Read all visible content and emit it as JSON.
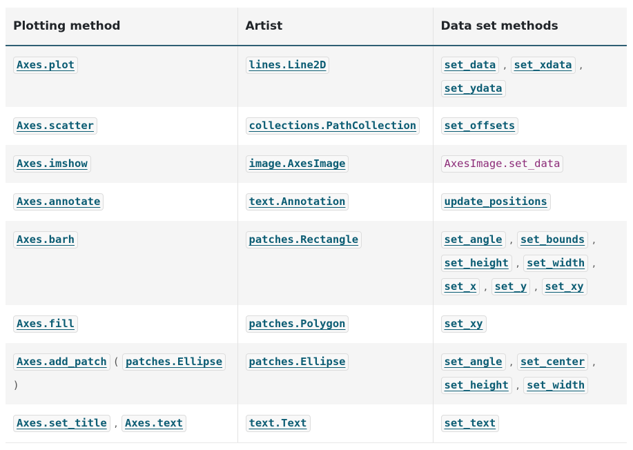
{
  "table": {
    "headers": [
      "Plotting method",
      "Artist",
      "Data set methods"
    ],
    "rows": [
      {
        "method": [
          {
            "t": "Axes.plot",
            "link": true
          }
        ],
        "artist": [
          {
            "t": "lines.Line2D",
            "link": true
          }
        ],
        "data_methods": [
          {
            "t": "set_data",
            "link": true
          },
          {
            "s": ","
          },
          {
            "t": "set_xdata",
            "link": true
          },
          {
            "s": ","
          },
          {
            "t": "set_ydata",
            "link": true
          }
        ]
      },
      {
        "method": [
          {
            "t": "Axes.scatter",
            "link": true
          }
        ],
        "artist": [
          {
            "t": "collections.PathCollection",
            "link": true
          }
        ],
        "data_methods": [
          {
            "t": "set_offsets",
            "link": true
          }
        ]
      },
      {
        "method": [
          {
            "t": "Axes.imshow",
            "link": true
          }
        ],
        "artist": [
          {
            "t": "image.AxesImage",
            "link": true
          }
        ],
        "data_methods": [
          {
            "t": "AxesImage.set_data",
            "link": false
          }
        ]
      },
      {
        "method": [
          {
            "t": "Axes.annotate",
            "link": true
          }
        ],
        "artist": [
          {
            "t": "text.Annotation",
            "link": true
          }
        ],
        "data_methods": [
          {
            "t": "update_positions",
            "link": true
          }
        ]
      },
      {
        "method": [
          {
            "t": "Axes.barh",
            "link": true
          }
        ],
        "artist": [
          {
            "t": "patches.Rectangle",
            "link": true
          }
        ],
        "data_methods": [
          {
            "t": "set_angle",
            "link": true
          },
          {
            "s": ","
          },
          {
            "t": "set_bounds",
            "link": true
          },
          {
            "s": ","
          },
          {
            "t": "set_height",
            "link": true
          },
          {
            "s": ","
          },
          {
            "t": "set_width",
            "link": true
          },
          {
            "s": ","
          },
          {
            "t": "set_x",
            "link": true
          },
          {
            "s": ","
          },
          {
            "t": "set_y",
            "link": true
          },
          {
            "s": ","
          },
          {
            "t": "set_xy",
            "link": true
          }
        ]
      },
      {
        "method": [
          {
            "t": "Axes.fill",
            "link": true
          }
        ],
        "artist": [
          {
            "t": "patches.Polygon",
            "link": true
          }
        ],
        "data_methods": [
          {
            "t": "set_xy",
            "link": true
          }
        ]
      },
      {
        "method": [
          {
            "t": "Axes.add_patch",
            "link": true
          },
          {
            "s": "("
          },
          {
            "t": "patches.Ellipse",
            "link": true
          },
          {
            "s": ")"
          }
        ],
        "artist": [
          {
            "t": "patches.Ellipse",
            "link": true
          }
        ],
        "data_methods": [
          {
            "t": "set_angle",
            "link": true
          },
          {
            "s": ","
          },
          {
            "t": "set_center",
            "link": true
          },
          {
            "s": ","
          },
          {
            "t": "set_height",
            "link": true
          },
          {
            "s": ","
          },
          {
            "t": "set_width",
            "link": true
          }
        ]
      },
      {
        "method": [
          {
            "t": "Axes.set_title",
            "link": true
          },
          {
            "s": ","
          },
          {
            "t": "Axes.text",
            "link": true
          }
        ],
        "artist": [
          {
            "t": "text.Text",
            "link": true
          }
        ],
        "data_methods": [
          {
            "t": "set_text",
            "link": true
          }
        ]
      }
    ]
  }
}
